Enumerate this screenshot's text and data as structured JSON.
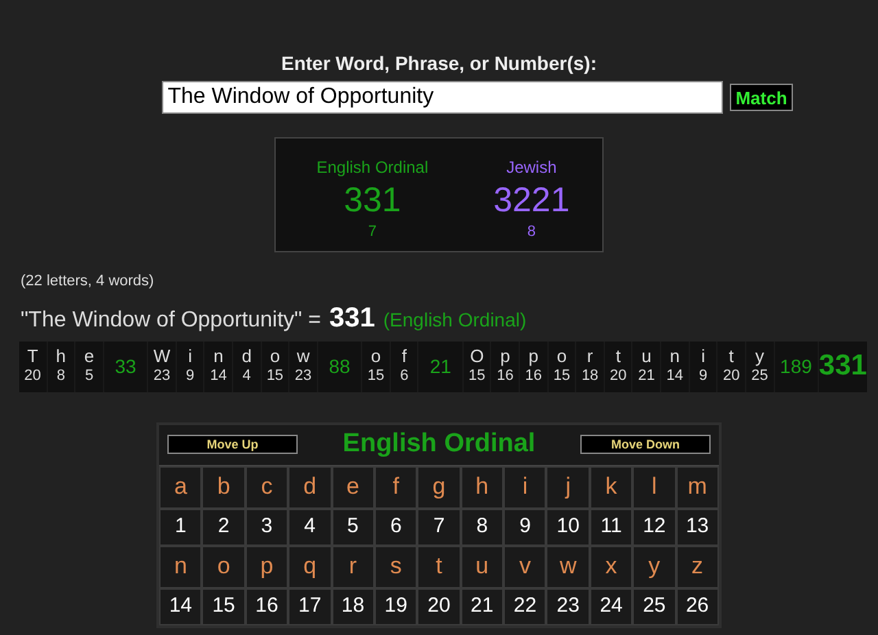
{
  "heading": "Enter Word, Phrase, or Number(s):",
  "search": {
    "value": "The Window of Opportunity",
    "button": "Match"
  },
  "results": [
    {
      "label": "English Ordinal",
      "value": "331",
      "sub": "7",
      "color": "#1aa31a"
    },
    {
      "label": "Jewish",
      "value": "3221",
      "sub": "8",
      "color": "#9966ff"
    }
  ],
  "counts": "(22 letters, 4 words)",
  "summary": {
    "phrase": "\"The Window of Opportunity\" =",
    "value": "331",
    "cipher": "(English Ordinal)"
  },
  "breakdown": {
    "words": [
      {
        "letters": [
          {
            "char": "T",
            "value": "20"
          },
          {
            "char": "h",
            "value": "8"
          },
          {
            "char": "e",
            "value": "5"
          }
        ],
        "total": "33"
      },
      {
        "letters": [
          {
            "char": "W",
            "value": "23"
          },
          {
            "char": "i",
            "value": "9"
          },
          {
            "char": "n",
            "value": "14"
          },
          {
            "char": "d",
            "value": "4"
          },
          {
            "char": "o",
            "value": "15"
          },
          {
            "char": "w",
            "value": "23"
          }
        ],
        "total": "88"
      },
      {
        "letters": [
          {
            "char": "o",
            "value": "15"
          },
          {
            "char": "f",
            "value": "6"
          }
        ],
        "total": "21"
      },
      {
        "letters": [
          {
            "char": "O",
            "value": "15"
          },
          {
            "char": "p",
            "value": "16"
          },
          {
            "char": "p",
            "value": "16"
          },
          {
            "char": "o",
            "value": "15"
          },
          {
            "char": "r",
            "value": "18"
          },
          {
            "char": "t",
            "value": "20"
          },
          {
            "char": "u",
            "value": "21"
          },
          {
            "char": "n",
            "value": "14"
          },
          {
            "char": "i",
            "value": "9"
          },
          {
            "char": "t",
            "value": "20"
          },
          {
            "char": "y",
            "value": "25"
          }
        ],
        "total": "189"
      }
    ],
    "grand_total": "331"
  },
  "cipher_table": {
    "move_up": "Move Up",
    "title": "English Ordinal",
    "move_down": "Move Down",
    "cells": [
      {
        "letter": "a",
        "value": "1"
      },
      {
        "letter": "b",
        "value": "2"
      },
      {
        "letter": "c",
        "value": "3"
      },
      {
        "letter": "d",
        "value": "4"
      },
      {
        "letter": "e",
        "value": "5"
      },
      {
        "letter": "f",
        "value": "6"
      },
      {
        "letter": "g",
        "value": "7"
      },
      {
        "letter": "h",
        "value": "8"
      },
      {
        "letter": "i",
        "value": "9"
      },
      {
        "letter": "j",
        "value": "10"
      },
      {
        "letter": "k",
        "value": "11"
      },
      {
        "letter": "l",
        "value": "12"
      },
      {
        "letter": "m",
        "value": "13"
      },
      {
        "letter": "n",
        "value": "14"
      },
      {
        "letter": "o",
        "value": "15"
      },
      {
        "letter": "p",
        "value": "16"
      },
      {
        "letter": "q",
        "value": "17"
      },
      {
        "letter": "r",
        "value": "18"
      },
      {
        "letter": "s",
        "value": "19"
      },
      {
        "letter": "t",
        "value": "20"
      },
      {
        "letter": "u",
        "value": "21"
      },
      {
        "letter": "v",
        "value": "22"
      },
      {
        "letter": "w",
        "value": "23"
      },
      {
        "letter": "x",
        "value": "24"
      },
      {
        "letter": "y",
        "value": "25"
      },
      {
        "letter": "z",
        "value": "26"
      }
    ]
  }
}
